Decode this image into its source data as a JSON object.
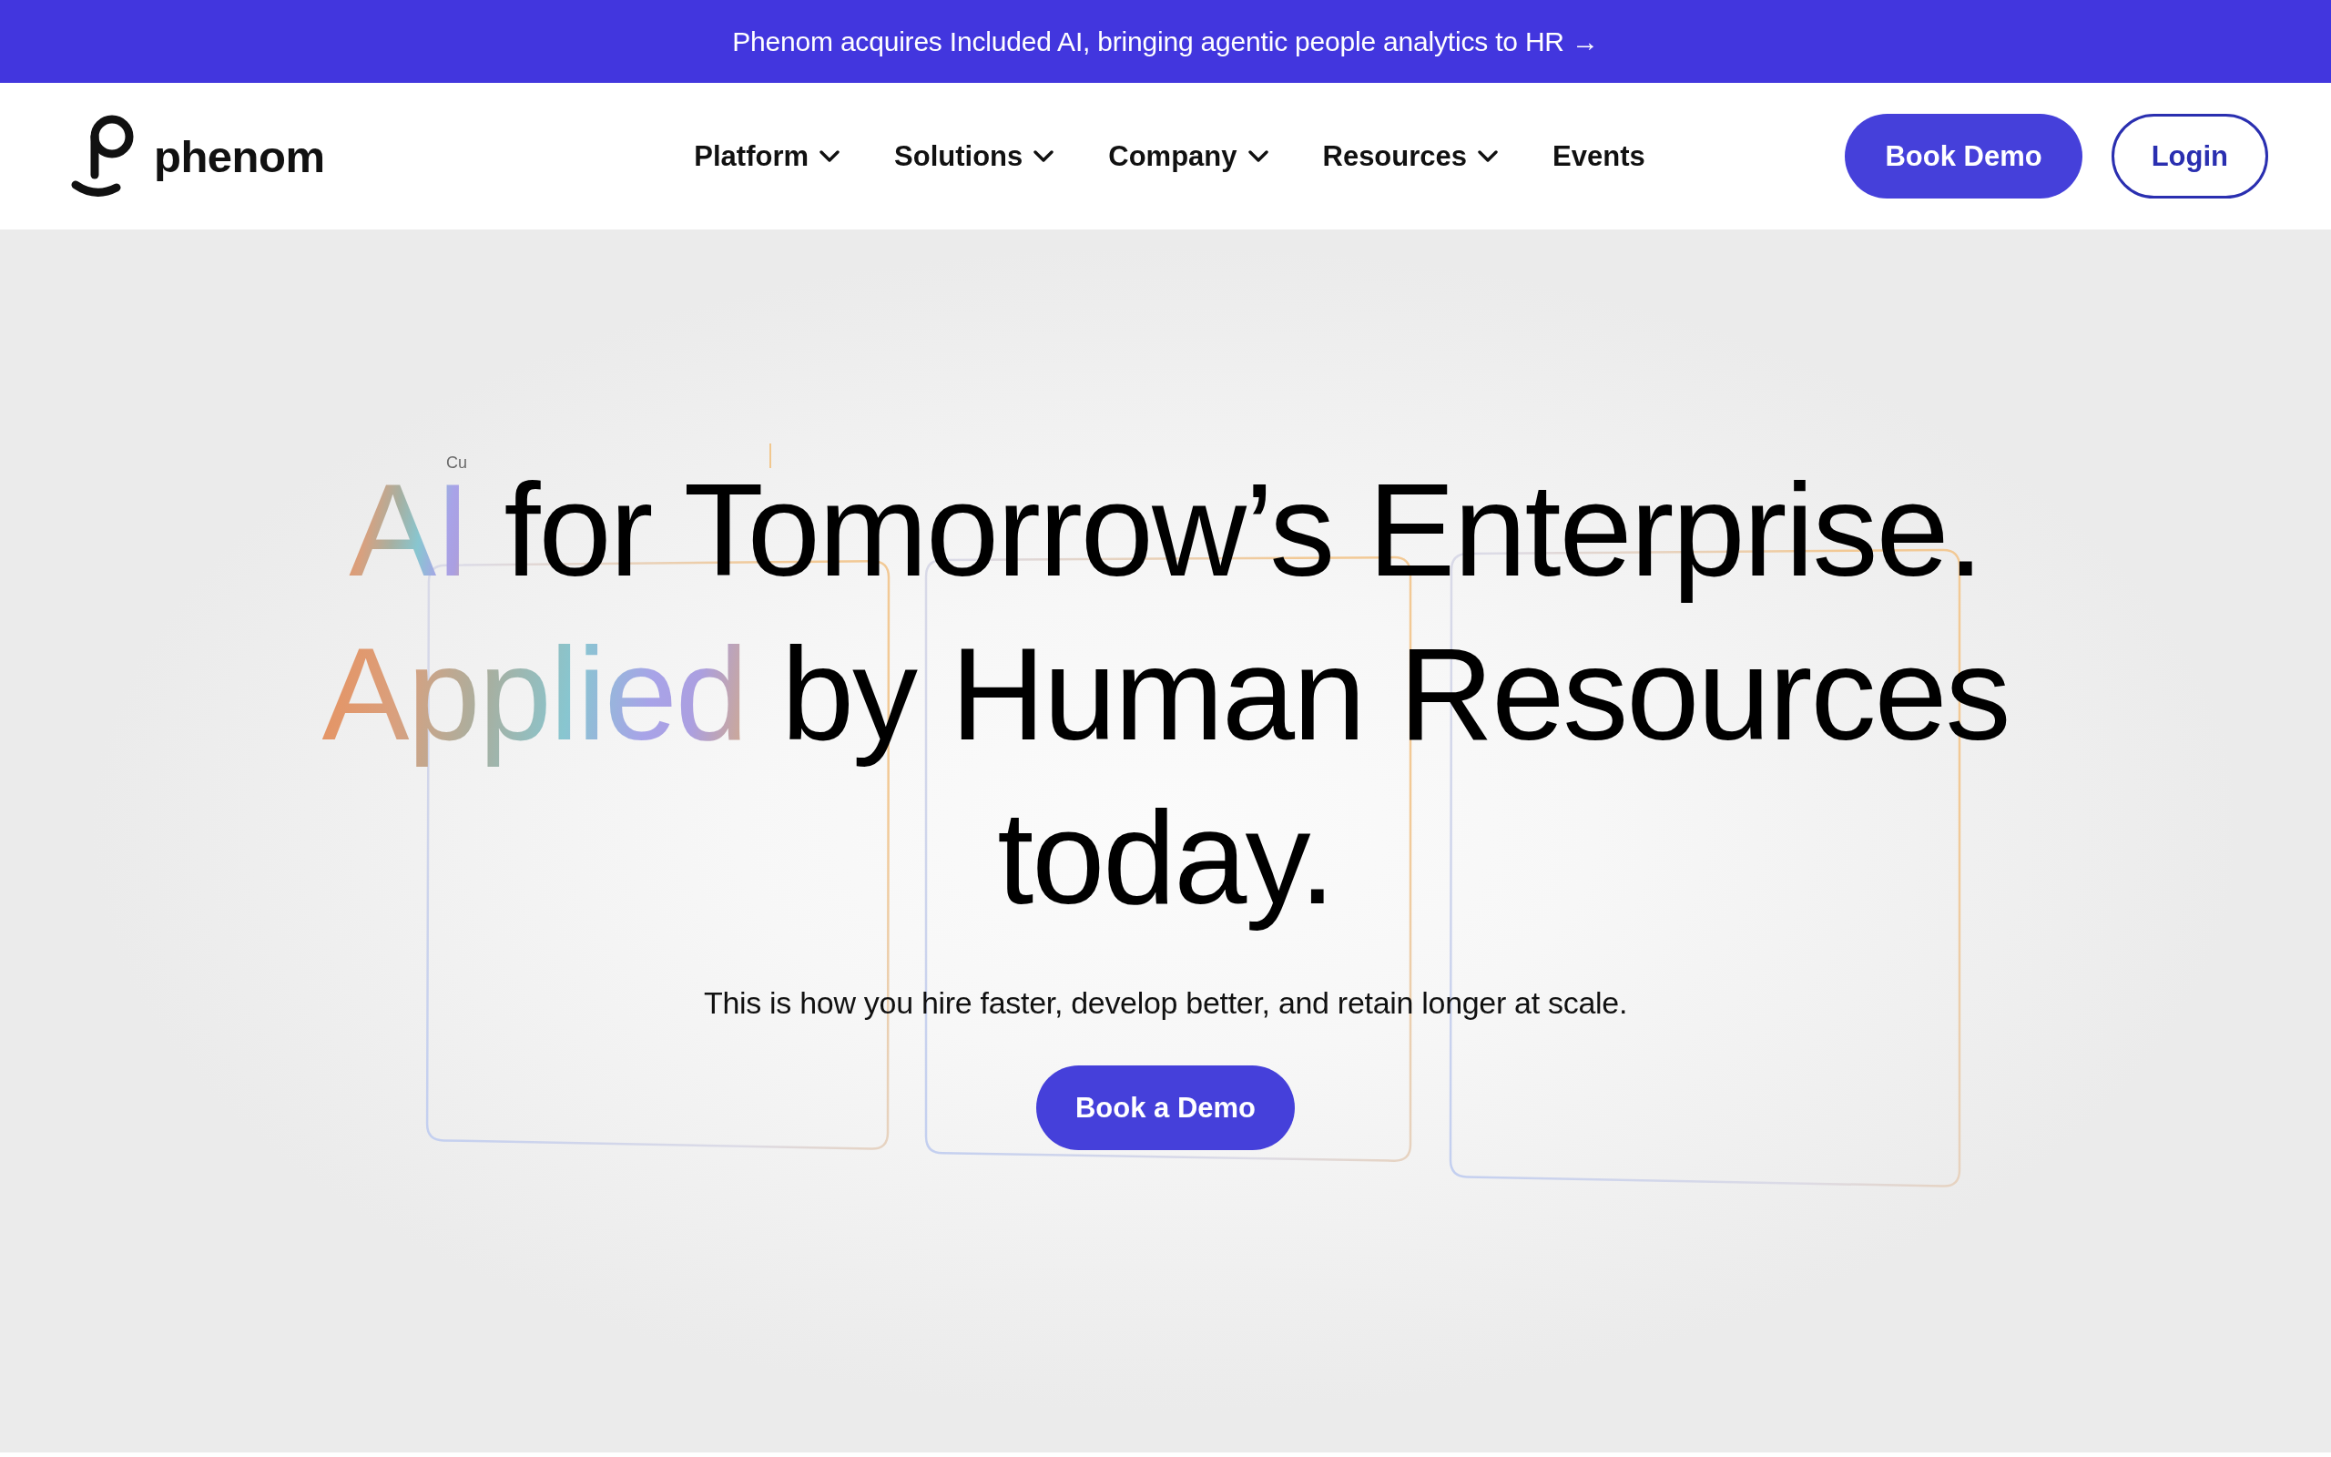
{
  "announcement": {
    "text": "Phenom acquires Included AI, bringing agentic people analytics to HR →"
  },
  "header": {
    "logo": {
      "wordmark": "phenom"
    },
    "nav": [
      {
        "label": "Platform",
        "dropdown": true
      },
      {
        "label": "Solutions",
        "dropdown": true
      },
      {
        "label": "Company",
        "dropdown": true
      },
      {
        "label": "Resources",
        "dropdown": true
      },
      {
        "label": "Events",
        "dropdown": false
      }
    ],
    "buttons": [
      {
        "label": "Book Demo",
        "kind": "primary"
      },
      {
        "label": "Login",
        "kind": "outline"
      }
    ]
  },
  "hero": {
    "floating_label": "Cu",
    "heading": [
      [
        {
          "text": "AI",
          "highlight": true
        },
        {
          "text": " for Tomorrow’s Enterprise.",
          "highlight": false
        }
      ],
      [
        {
          "text": "Applied",
          "highlight": true
        },
        {
          "text": " by Human Resources",
          "highlight": false
        }
      ],
      [
        {
          "text": "today.",
          "highlight": false
        }
      ]
    ],
    "subtitle": "This is how you hire faster, develop better, and retain longer at scale.",
    "cta": {
      "label": "Book a Demo"
    }
  }
}
